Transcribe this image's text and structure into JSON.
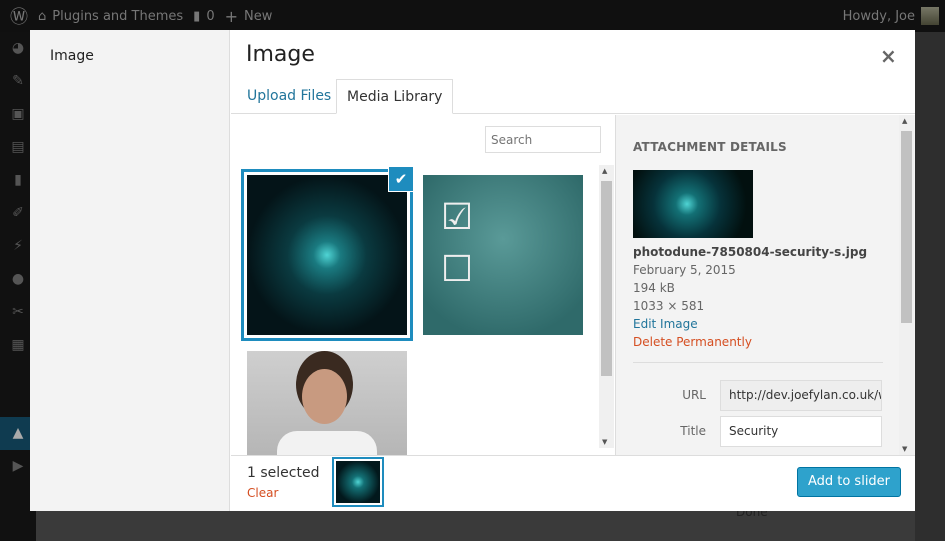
{
  "adminbar": {
    "site_name": "Plugins and Themes",
    "comments_count": "0",
    "new_label": "New",
    "greeting": "Howdy, Joe"
  },
  "modal": {
    "menu": {
      "items": [
        {
          "label": "Image"
        }
      ]
    },
    "title": "Image",
    "close_icon": "×",
    "tabs": [
      {
        "label": "Upload Files",
        "active": false
      },
      {
        "label": "Media Library",
        "active": true
      }
    ],
    "search": {
      "placeholder": "Search",
      "value": ""
    },
    "attachments": [
      {
        "name": "security",
        "selected": true
      },
      {
        "name": "checkbox-chalkboard",
        "selected": false
      },
      {
        "name": "woman-thinking",
        "selected": false
      }
    ],
    "details": {
      "heading": "ATTACHMENT DETAILS",
      "filename": "photodune-7850804-security-s.jpg",
      "date": "February 5, 2015",
      "filesize": "194 kB",
      "dimensions": "1033 × 581",
      "edit_link": "Edit Image",
      "delete_link": "Delete Permanently",
      "fields": [
        {
          "label": "URL",
          "value": "http://dev.joefylan.co.uk/w"
        },
        {
          "label": "Title",
          "value": "Security"
        }
      ]
    },
    "footer": {
      "selected_count": "1 selected",
      "clear_label": "Clear",
      "add_button": "Add to slider"
    }
  },
  "background": {
    "partial_text": "Done"
  },
  "colors": {
    "accent": "#1e8cbe",
    "button": "#2ea2cc",
    "danger": "#d54e21",
    "link": "#21759b"
  }
}
